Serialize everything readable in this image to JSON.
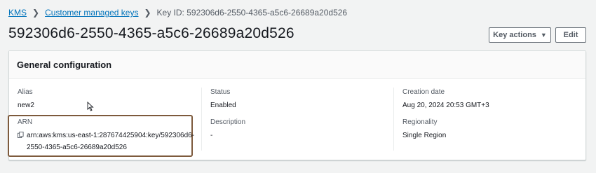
{
  "breadcrumb": {
    "items": [
      "KMS",
      "Customer managed keys"
    ],
    "current": "Key ID: 592306d6-2550-4365-a5c6-26689a20d526"
  },
  "page": {
    "title": "592306d6-2550-4365-a5c6-26689a20d526"
  },
  "actions": {
    "key_actions_label": "Key actions",
    "edit_label": "Edit"
  },
  "panel": {
    "title": "General configuration",
    "fields": {
      "alias": {
        "label": "Alias",
        "value": "new2"
      },
      "status": {
        "label": "Status",
        "value": "Enabled"
      },
      "creation_date": {
        "label": "Creation date",
        "value": "Aug 20, 2024 20:53 GMT+3"
      },
      "arn": {
        "label": "ARN",
        "value_line1": "arn:aws:kms:us-east-1:287674425904:key/592306d6-",
        "value_line2": "2550-4365-a5c6-26689a20d526"
      },
      "description": {
        "label": "Description",
        "value": "-"
      },
      "regionality": {
        "label": "Regionality",
        "value": "Single Region"
      }
    }
  },
  "icons": {
    "copy": "copy-icon",
    "caret": "caret-down-icon",
    "chevron": "chevron-right-icon"
  },
  "colors": {
    "link": "#0073bb",
    "highlight_border": "#7d5a3c"
  }
}
